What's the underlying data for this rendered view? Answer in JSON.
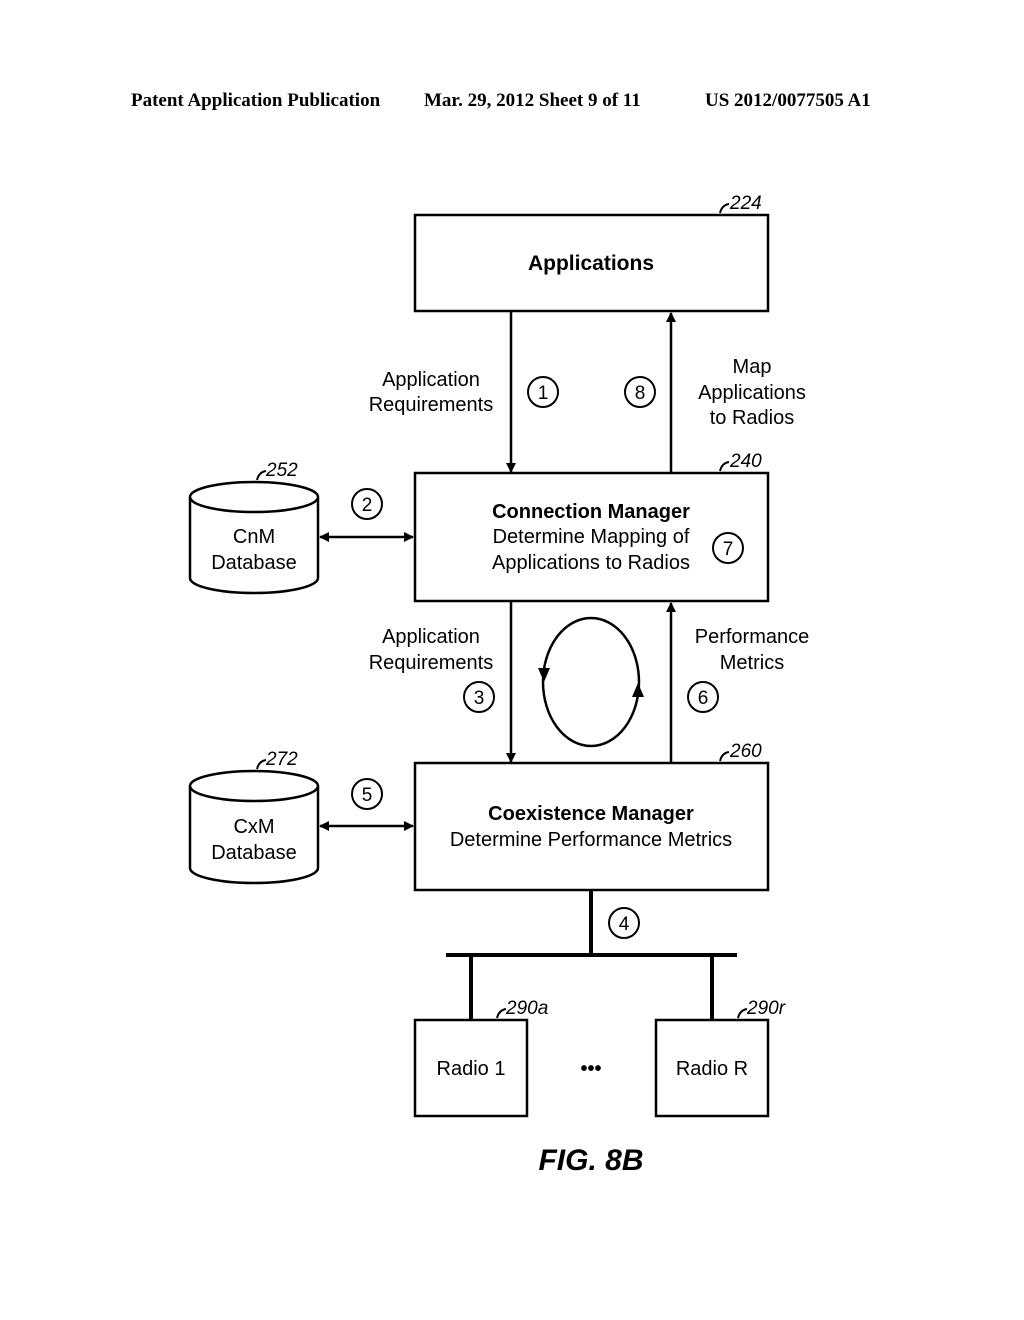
{
  "header": {
    "publication": "Patent Application Publication",
    "date_sheet": "Mar. 29, 2012  Sheet 9 of 11",
    "pub_number": "US 2012/0077505 A1"
  },
  "blocks": {
    "applications": {
      "title": "Applications",
      "ref": "224"
    },
    "connection_manager": {
      "title": "Connection Manager",
      "line1": "Determine Mapping of",
      "line2": "Applications to Radios",
      "ref": "240"
    },
    "coexistence_manager": {
      "title": "Coexistence Manager",
      "line1": "Determine Performance Metrics",
      "ref": "260"
    },
    "cnm_database": {
      "line1": "CnM",
      "line2": "Database",
      "ref": "252"
    },
    "cxm_database": {
      "line1": "CxM",
      "line2": "Database",
      "ref": "272"
    },
    "radio_1": {
      "label": "Radio 1",
      "ref": "290a"
    },
    "radio_r": {
      "label": "Radio R",
      "ref": "290r"
    },
    "ellipsis": "•••"
  },
  "labels": {
    "app_req_top": {
      "line1": "Application",
      "line2": "Requirements"
    },
    "map_apps": {
      "line1": "Map",
      "line2": "Applications",
      "line3": "to Radios"
    },
    "app_req_mid": {
      "line1": "Application",
      "line2": "Requirements"
    },
    "perf_metrics": {
      "line1": "Performance",
      "line2": "Metrics"
    }
  },
  "steps": [
    "1",
    "2",
    "3",
    "4",
    "5",
    "6",
    "7",
    "8"
  ],
  "figure_caption": "FIG. 8B"
}
